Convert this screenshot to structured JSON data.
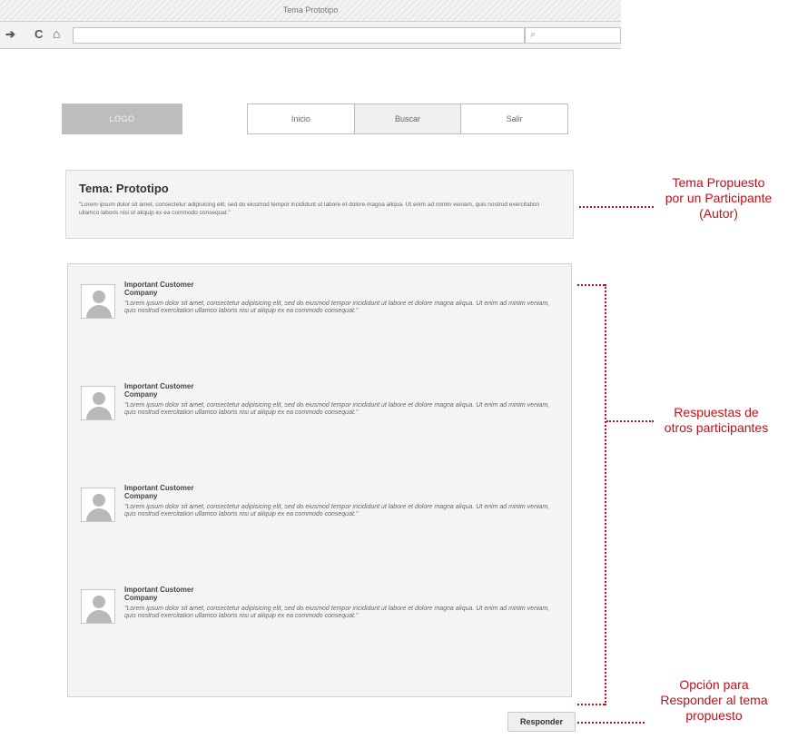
{
  "browser": {
    "window_title": "Tema Prototipo",
    "back_glyph": "➔",
    "reload_glyph": "C",
    "home_glyph": "⌂",
    "url": "",
    "search_glyph": "⌕"
  },
  "header": {
    "logo": "LOGO",
    "nav": [
      "Inicio",
      "Buscar",
      "Salir"
    ],
    "active_nav": "Buscar"
  },
  "topic": {
    "title": "Tema: Prototipo",
    "body": "\"Lorem ipsum dolor sit amet, consectetur adipisicing elit, sed do eiusmod tempor incididunt ut labore et dolore magna aliqua. Ut enim ad minim veniam, quis nostrud exercitation ullamco laboris nisi ut aliquip ex ea commodo consequat.\""
  },
  "responses": [
    {
      "author_line1": "Important Customer",
      "author_line2": "Company",
      "text": "\"Lorem ipsum dolor sit amet, consectetur adipisicing elit, sed do eiusmod tempor incididunt ut labore et dolore magna aliqua. Ut enim ad minim veniam, quis nostrud exercitation ullamco laboris nisi ut aliquip ex ea commodo consequat.\""
    },
    {
      "author_line1": "Important Customer",
      "author_line2": "Company",
      "text": "\"Lorem ipsum dolor sit amet, consectetur adipisicing elit, sed do eiusmod tempor incididunt ut labore et dolore magna aliqua. Ut enim ad minim veniam, quis nostrud exercitation ullamco laboris nisi ut aliquip ex ea commodo consequat.\""
    },
    {
      "author_line1": "Important Customer",
      "author_line2": "Company",
      "text": "\"Lorem ipsum dolor sit amet, consectetur adipisicing elit, sed do eiusmod tempor incididunt ut labore et dolore magna aliqua. Ut enim ad minim veniam, quis nostrud exercitation ullamco laboris nisi ut aliquip ex ea commodo consequat.\""
    },
    {
      "author_line1": "Important Customer",
      "author_line2": "Company",
      "text": "\"Lorem ipsum dolor sit amet, consectetur adipisicing elit, sed do eiusmod tempor incididunt ut labore et dolore magna aliqua. Ut enim ad minim veniam, quis nostrud exercitation ullamco laboris nisi ut aliquip ex ea commodo consequat.\""
    }
  ],
  "reply_button": "Responder",
  "annotations": {
    "topic_note": [
      "Tema Propuesto",
      "por un Participante",
      "(Autor)"
    ],
    "responses_note": [
      "Respuestas de",
      "otros participantes"
    ],
    "reply_note": [
      "Opción para",
      "Responder al tema",
      "propuesto"
    ]
  },
  "colors": {
    "annotation": "#c0101a",
    "panel_bg": "#f4f4f4",
    "logo_bg": "#bdbdbd"
  }
}
